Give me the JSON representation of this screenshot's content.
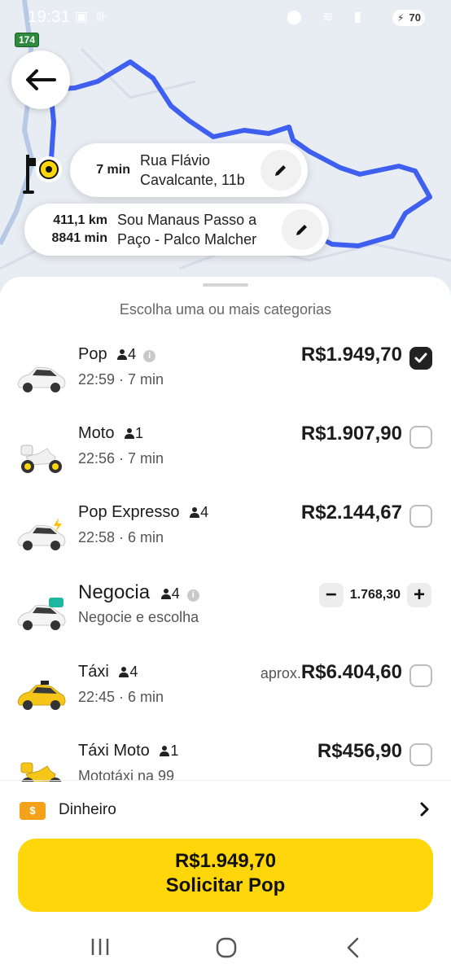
{
  "status_bar": {
    "time": "19:31",
    "battery": "70"
  },
  "map": {
    "road_badge": "174"
  },
  "route": {
    "pickup": {
      "eta": "7 min",
      "address_line1": "Rua Flávio",
      "address_line2": "Cavalcante, 11b"
    },
    "destination": {
      "distance": "411,1 km",
      "duration": "8841 min",
      "address_line1": "Sou Manaus Passo a",
      "address_line2": "Paço - Palco Malcher"
    }
  },
  "sheet": {
    "title": "Escolha uma ou mais categorias"
  },
  "categories": [
    {
      "name": "Pop",
      "pax": "4",
      "info": true,
      "sub": "22:59 · 7 min",
      "price": "R$1.949,70",
      "checked": true
    },
    {
      "name": "Moto",
      "pax": "1",
      "sub": "22:56 · 7 min",
      "price": "R$1.907,90",
      "checked": false
    },
    {
      "name": "Pop Expresso",
      "pax": "4",
      "sub": "22:58 · 6 min",
      "price": "R$2.144,67",
      "checked": false
    },
    {
      "name": "Negocia",
      "pax": "4",
      "info": true,
      "sub": "Negocie e escolha",
      "stepper_value": "1.768,30",
      "stepper_minus": "−",
      "stepper_plus": "+"
    },
    {
      "name": "Táxi",
      "pax": "4",
      "sub": "22:45 · 6 min",
      "price_prefix": "aprox.",
      "price": "R$6.404,60",
      "checked": false
    },
    {
      "name": "Táxi Moto",
      "pax": "1",
      "sub": "Mototáxi na 99",
      "price": "R$456,90",
      "checked": false
    }
  ],
  "payment": {
    "icon_text": "$",
    "label": "Dinheiro"
  },
  "cta": {
    "price": "R$1.949,70",
    "label": "Solicitar Pop"
  },
  "colors": {
    "accent_yellow": "#ffd60a",
    "route_blue": "#3f5ff0",
    "cash_orange": "#f5a21a"
  },
  "icons": [
    "back-arrow-icon",
    "pencil-icon",
    "person-icon",
    "info-icon",
    "checkmark-icon",
    "chevron-right-icon",
    "recents-icon",
    "home-icon",
    "back-icon"
  ]
}
